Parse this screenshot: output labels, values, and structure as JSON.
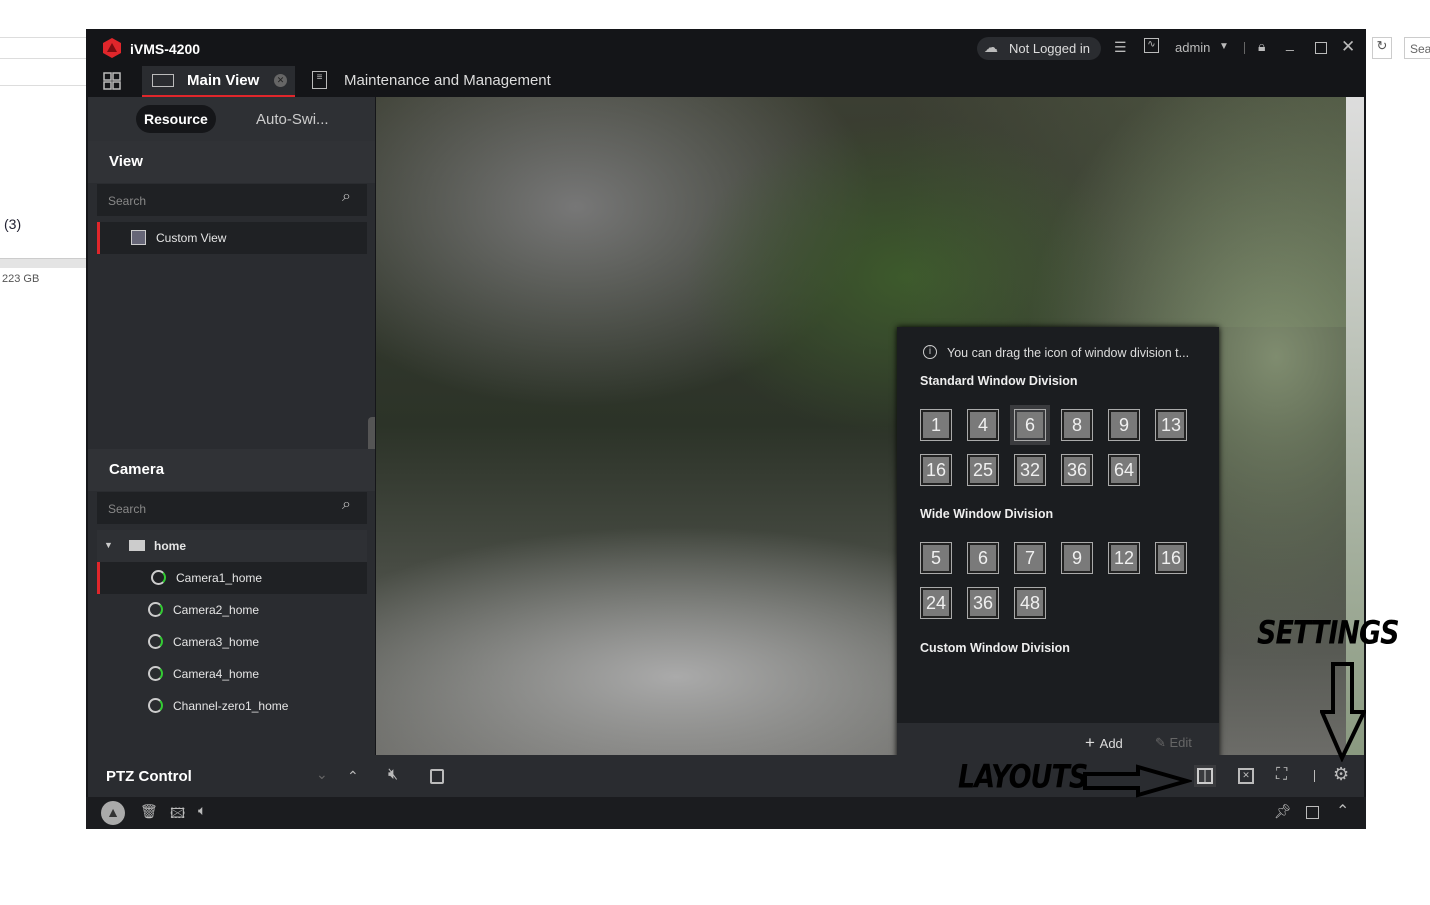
{
  "background": {
    "count": "(3)",
    "size": "223 GB",
    "search": "Sear"
  },
  "app": {
    "title": "iVMS-4200",
    "accent": "#e0262b"
  },
  "header": {
    "cloud_status": "Not Logged in",
    "user": "admin"
  },
  "tabs": [
    {
      "label": "Main View",
      "active": true
    },
    {
      "label": "Maintenance and Management"
    }
  ],
  "sidebar": {
    "top_tabs": [
      "Resource",
      "Auto-Swi..."
    ],
    "view": {
      "title": "View",
      "search_placeholder": "Search",
      "items": [
        "Custom View"
      ]
    },
    "camera": {
      "title": "Camera",
      "search_placeholder": "Search",
      "group": "home",
      "items": [
        "Camera1_home",
        "Camera2_home",
        "Camera3_home",
        "Camera4_home",
        "Channel-zero1_home"
      ]
    },
    "ptz": "PTZ Control"
  },
  "popup": {
    "hint": "You can drag the icon of window division t...",
    "standard_title": "Standard Window Division",
    "standard": [
      "1",
      "4",
      "6",
      "8",
      "9",
      "13",
      "16",
      "25",
      "32",
      "36",
      "64"
    ],
    "standard_selected": "6",
    "wide_title": "Wide Window Division",
    "wide": [
      "5",
      "6",
      "7",
      "9",
      "12",
      "16",
      "24",
      "36",
      "48"
    ],
    "custom_title": "Custom Window Division",
    "add": "Add",
    "edit": "Edit"
  },
  "annotations": {
    "settings": "SETTINGS",
    "layouts": "LAYOUTS"
  }
}
